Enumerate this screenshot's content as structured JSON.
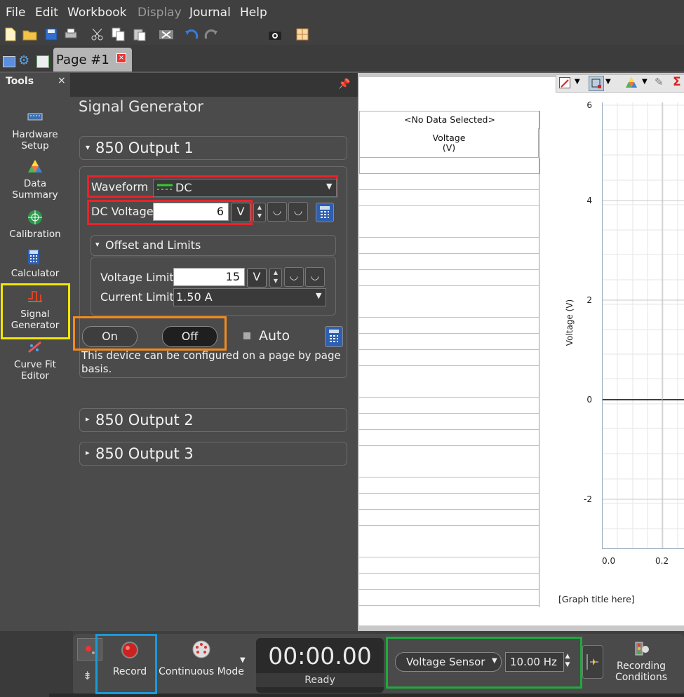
{
  "menu": {
    "file": "File",
    "edit": "Edit",
    "workbook": "Workbook",
    "display": "Display",
    "journal": "Journal",
    "help": "Help"
  },
  "tab": {
    "label": "Page #1",
    "close": "×"
  },
  "tools": {
    "title": "Tools",
    "close": "×",
    "items": [
      {
        "label": "Hardware\nSetup"
      },
      {
        "label": "Data\nSummary"
      },
      {
        "label": "Calibration"
      },
      {
        "label": "Calculator"
      },
      {
        "label": "Signal\nGenerator"
      },
      {
        "label": "Curve Fit\nEditor"
      }
    ]
  },
  "signal": {
    "title": "Signal Generator",
    "output1": "850 Output 1",
    "waveform_label": "Waveform",
    "waveform_value": "DC",
    "dc_voltage_label": "DC Voltage",
    "dc_voltage_value": "6",
    "dc_voltage_unit": "V",
    "offset_title": "Offset and Limits",
    "voltage_limit_label": "Voltage Limit",
    "voltage_limit_value": "15",
    "voltage_limit_unit": "V",
    "current_limit_label": "Current Limit",
    "current_limit_value": "1.50 A",
    "on_label": "On",
    "off_label": "Off",
    "auto_label": "Auto",
    "note": "This device can be configured on a page by page basis.",
    "output2": "850 Output 2",
    "output3": "850 Output 3"
  },
  "table": {
    "header": "<No Data Selected>",
    "column": "Voltage",
    "unit": "(V)"
  },
  "graph": {
    "ylabel": "Voltage (V)",
    "yticks": [
      "6",
      "4",
      "2",
      "0",
      "-2"
    ],
    "xticks": [
      "0.0",
      "0.2"
    ],
    "title_placeholder": "[Graph title here]"
  },
  "bottom": {
    "record": "Record",
    "mode": "Continuous Mode",
    "time": "00:00.00",
    "status": "Ready",
    "sensor": "Voltage Sensor",
    "rate": "10.00 Hz",
    "conditions": "Recording\nConditions"
  },
  "colors": {
    "red_highlight": "#e8232a",
    "yellow_highlight": "#f2e600",
    "orange_highlight": "#f28a1e",
    "blue_highlight": "#1a9ad9",
    "green_highlight": "#1eaa3c"
  }
}
